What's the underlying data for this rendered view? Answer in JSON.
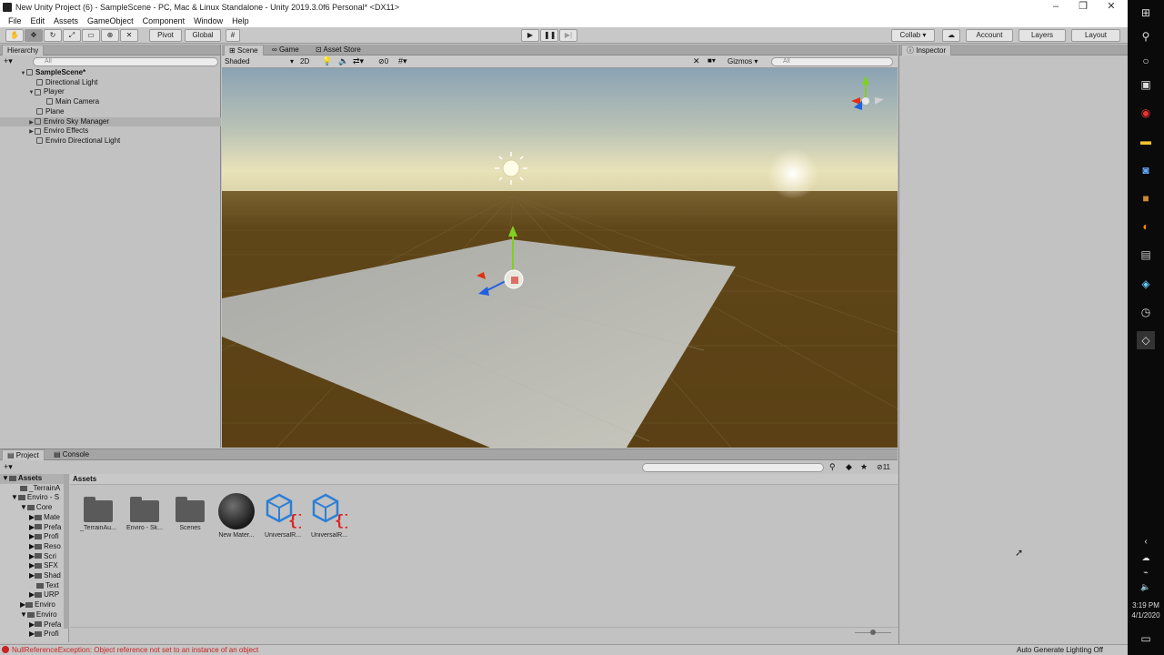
{
  "window": {
    "title": "New Unity Project (6) - SampleScene - PC, Mac & Linux Standalone - Unity 2019.3.0f6 Personal* <DX11>"
  },
  "menu": [
    "File",
    "Edit",
    "Assets",
    "GameObject",
    "Component",
    "Window",
    "Help"
  ],
  "toolbar": {
    "pivot": "Pivot",
    "global": "Global",
    "collab": "Collab ▾",
    "account": "Account",
    "layers": "Layers",
    "layout": "Layout"
  },
  "hierarchy": {
    "tab": "Hierarchy",
    "search_placeholder": "All",
    "items": [
      {
        "label": "SampleScene*"
      },
      {
        "label": "Directional Light"
      },
      {
        "label": "Player"
      },
      {
        "label": "Main Camera"
      },
      {
        "label": "Plane"
      },
      {
        "label": "Enviro Sky Manager"
      },
      {
        "label": "Enviro Effects"
      },
      {
        "label": "Enviro Directional Light"
      }
    ]
  },
  "scene": {
    "tabs": [
      "Scene",
      "Game",
      "Asset Store"
    ],
    "shading": "Shaded",
    "mode_2d": "2D",
    "hidden_count": "0",
    "gizmos": "Gizmos",
    "search_placeholder": "All"
  },
  "inspector": {
    "tab": "Inspector"
  },
  "project": {
    "tabs": [
      "Project",
      "Console"
    ],
    "breadcrumb": "Assets",
    "count": "11",
    "tree": [
      "Assets",
      "_TerrainA",
      "Enviro - S",
      "Core",
      "Mate",
      "Prefa",
      "Profi",
      "Reso",
      "Scri",
      "SFX",
      "Shad",
      "Text",
      "URP",
      "Enviro",
      "Enviro",
      "Prefa",
      "Profi"
    ],
    "assets": [
      {
        "label": "_TerrainAu..."
      },
      {
        "label": "Enviro - Sk..."
      },
      {
        "label": "Scenes"
      },
      {
        "label": "New Mater..."
      },
      {
        "label": "UniversalR..."
      },
      {
        "label": "UniversalR..."
      }
    ]
  },
  "status": {
    "error": "NullReferenceException: Object reference not set to an instance of an object",
    "lighting": "Auto Generate Lighting Off"
  },
  "taskbar": {
    "time": "3:19 PM",
    "date": "4/1/2020"
  },
  "colors": {
    "error": "#cc2222",
    "selection": "#b0b0b0",
    "ground": "#5a4014",
    "plane": "#b8b8b0"
  }
}
